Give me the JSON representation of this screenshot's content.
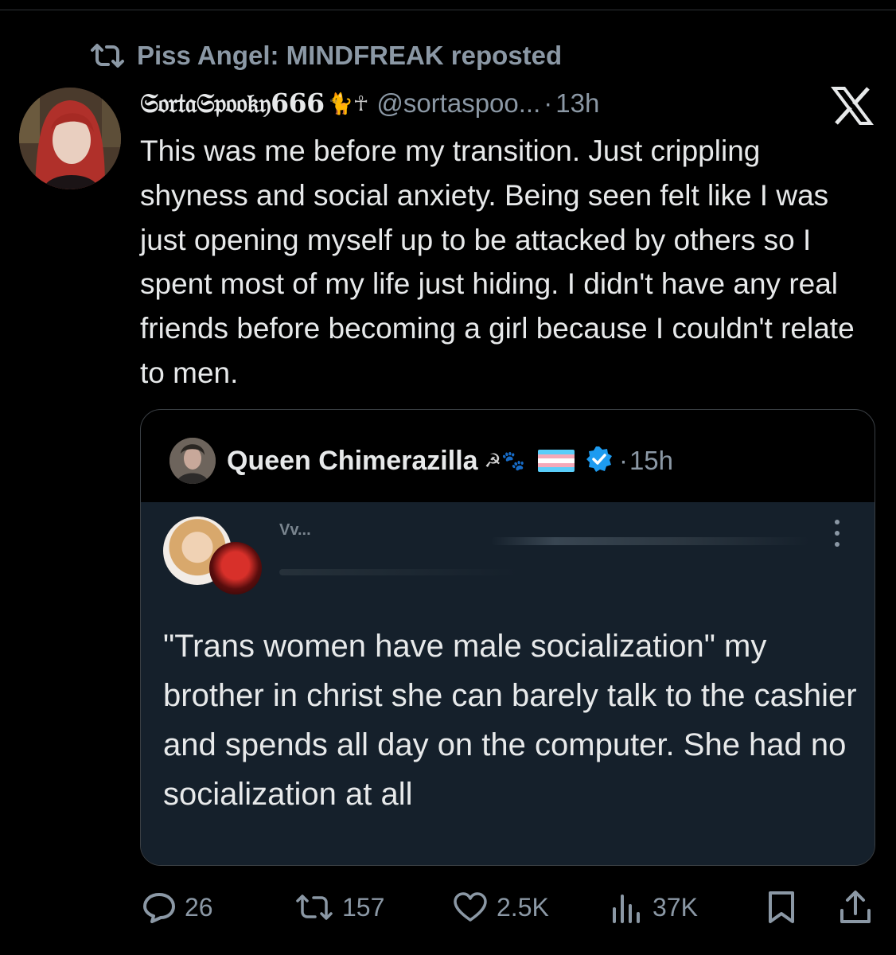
{
  "repost": {
    "icon": "repost-icon",
    "text": "Piss Angel: MINDFREAK reposted"
  },
  "tweet": {
    "display_name": "𝔖𝔬𝔯𝔱𝔞𝔖𝔭𝔬𝔬𝔨𝔶666",
    "name_emoji": "🐈☥",
    "handle": "@sortaspoo...",
    "separator": "·",
    "time": "13h",
    "platform_icon": "x-logo-icon",
    "text": "This was me before my transition. Just crippling shyness and social anxiety. Being seen felt like I was just opening myself up to be attacked by others so I spent most of my life just hiding. I didn't have any real friends before becoming a girl because I couldn't relate to men."
  },
  "quote": {
    "name": "Queen Chimerazilla",
    "name_symbols": "☭🐾",
    "flag_colors": [
      "#5bcefa",
      "#f5a9b8",
      "#ffffff",
      "#f5a9b8",
      "#5bcefa"
    ],
    "verified_color": "#1d9bf0",
    "separator": "·",
    "time": "15h",
    "screenshot": {
      "name_fragment": "Vv...",
      "text": "\"Trans women have male socialization\" my brother in christ she can barely talk to the cashier and spends all day on the computer. She had no socialization at all"
    }
  },
  "actions": {
    "replies": "26",
    "reposts": "157",
    "likes": "2.5K",
    "views": "37K",
    "icons": [
      "reply-icon",
      "repost-icon",
      "like-icon",
      "views-icon",
      "bookmark-icon",
      "share-icon"
    ]
  },
  "colors": {
    "background": "#000000",
    "muted": "#8b98a5",
    "text": "#e7e9ea"
  }
}
